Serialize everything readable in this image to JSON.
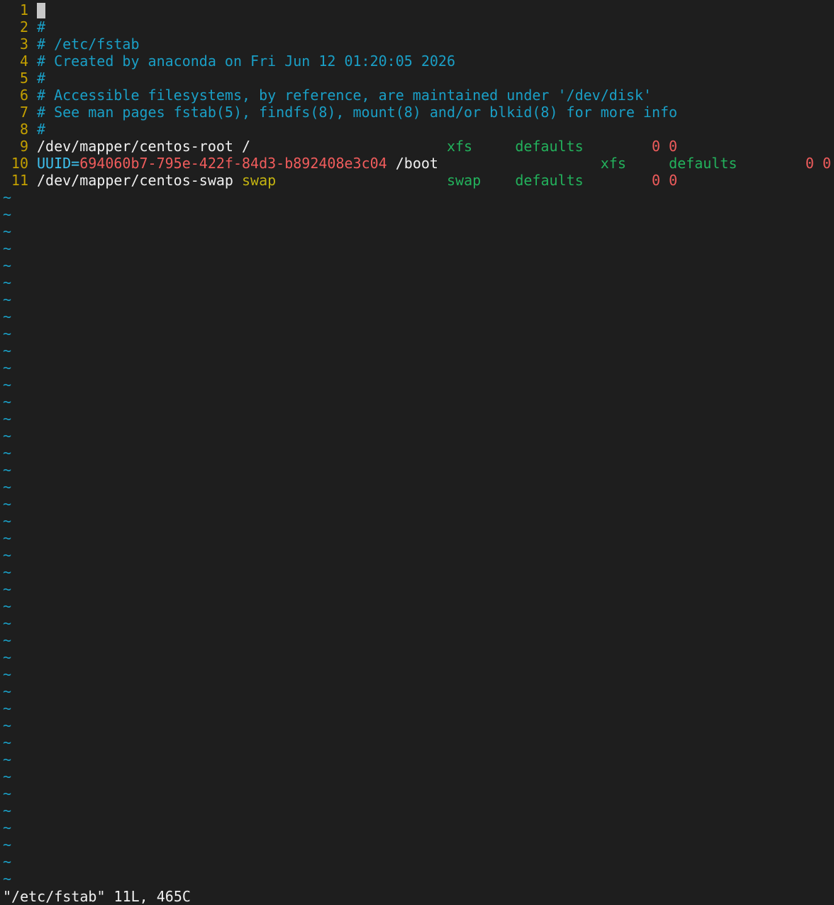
{
  "editor": {
    "lines": [
      {
        "num": "1",
        "tokens": [],
        "cursor": true
      },
      {
        "num": "2",
        "tokens": [
          {
            "text": "#",
            "color": "#1a9fc6"
          }
        ]
      },
      {
        "num": "3",
        "tokens": [
          {
            "text": "# /etc/fstab",
            "color": "#1a9fc6"
          }
        ]
      },
      {
        "num": "4",
        "tokens": [
          {
            "text": "# Created by anaconda on Fri Jun 12 01:20:05 2026",
            "color": "#1a9fc6"
          }
        ]
      },
      {
        "num": "5",
        "tokens": [
          {
            "text": "#",
            "color": "#1a9fc6"
          }
        ]
      },
      {
        "num": "6",
        "tokens": [
          {
            "text": "# Accessible filesystems, by reference, are maintained under '/dev/disk'",
            "color": "#1a9fc6"
          }
        ]
      },
      {
        "num": "7",
        "tokens": [
          {
            "text": "# See man pages fstab(5), findfs(8), mount(8) and/or blkid(8) for more info",
            "color": "#1a9fc6"
          }
        ]
      },
      {
        "num": "8",
        "tokens": [
          {
            "text": "#",
            "color": "#1a9fc6"
          }
        ]
      },
      {
        "num": "9",
        "tokens": [
          {
            "text": "/dev/mapper/centos-root /                       ",
            "color": "#f0f0f0"
          },
          {
            "text": "xfs",
            "color": "#23b25c"
          },
          {
            "text": "     ",
            "color": "#f0f0f0"
          },
          {
            "text": "defaults",
            "color": "#23b25c"
          },
          {
            "text": "        ",
            "color": "#f0f0f0"
          },
          {
            "text": "0 0",
            "color": "#f05c5c"
          }
        ]
      },
      {
        "num": "10",
        "tokens": [
          {
            "text": "UUID=",
            "color": "#3ec1ef"
          },
          {
            "text": "694060b7-795e-422f-84d3-b892408e3c04",
            "color": "#f05c5c"
          },
          {
            "text": " /boot                   ",
            "color": "#f0f0f0"
          },
          {
            "text": "xfs",
            "color": "#23b25c"
          },
          {
            "text": "     ",
            "color": "#f0f0f0"
          },
          {
            "text": "defaults",
            "color": "#23b25c"
          },
          {
            "text": "        ",
            "color": "#f0f0f0"
          },
          {
            "text": "0 0",
            "color": "#f05c5c"
          }
        ]
      },
      {
        "num": "11",
        "tokens": [
          {
            "text": "/dev/mapper/centos-swap ",
            "color": "#f0f0f0"
          },
          {
            "text": "swap",
            "color": "#c4b410"
          },
          {
            "text": "                    ",
            "color": "#f0f0f0"
          },
          {
            "text": "swap",
            "color": "#23b25c"
          },
          {
            "text": "    ",
            "color": "#f0f0f0"
          },
          {
            "text": "defaults",
            "color": "#23b25c"
          },
          {
            "text": "        ",
            "color": "#f0f0f0"
          },
          {
            "text": "0 0",
            "color": "#f05c5c"
          }
        ]
      }
    ],
    "empty_line_marker": "~",
    "empty_line_count": 41
  },
  "status": {
    "message": "\"/etc/fstab\" 11L, 465C"
  },
  "colors": {
    "background": "#1e1e1e",
    "line_number": "#c4a000",
    "comment": "#1a9fc6",
    "tilde": "#1a9fc6",
    "keyword_green": "#23b25c",
    "number_red": "#f05c5c",
    "uuid_label": "#3ec1ef",
    "swap_yellow": "#c4b410",
    "text": "#f0f0f0"
  }
}
